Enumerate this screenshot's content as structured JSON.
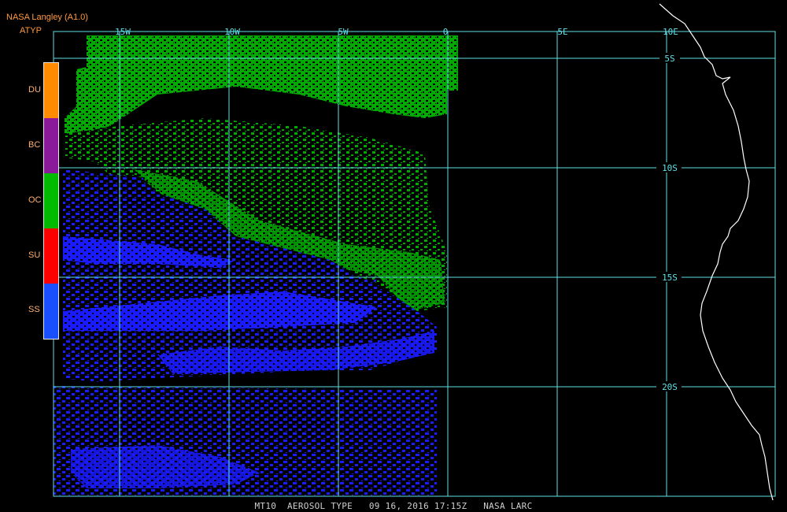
{
  "header": {
    "title": "NASA Langley (A1.0)",
    "product": "ATYP"
  },
  "legend": [
    {
      "label": "DU",
      "color": "#ff8c00"
    },
    {
      "label": "BC",
      "color": "#8b1a9b"
    },
    {
      "label": "OC",
      "color": "#00bb00"
    },
    {
      "label": "SU",
      "color": "#ff0000"
    },
    {
      "label": "SS",
      "color": "#1a4fff"
    }
  ],
  "grid": {
    "lon_labels": [
      "15W",
      "10W",
      "5W",
      "0",
      "5E",
      "10E"
    ],
    "lat_labels": [
      "5S",
      "10S",
      "15S",
      "20S"
    ],
    "color": "#5fe0e6"
  },
  "colors": {
    "coastline": "#ffffff",
    "aerosol_oc": "#00bb00",
    "aerosol_ss": "#1a1aff"
  },
  "footer": "MT10  AEROSOL TYPE   09 16, 2016 17:15Z   NASA LARC"
}
